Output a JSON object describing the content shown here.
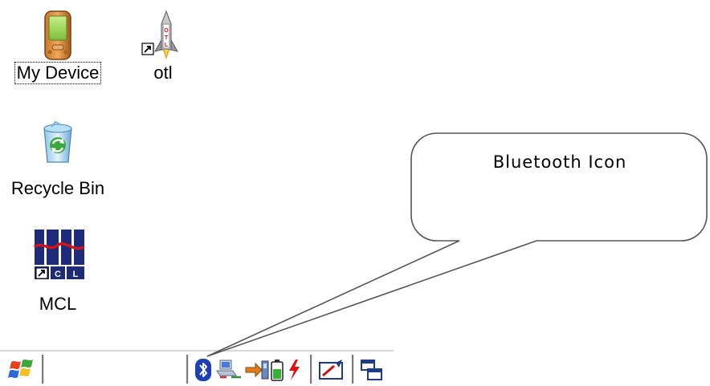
{
  "desktop": {
    "icons": [
      {
        "label": "My Device",
        "icon": "pda-device-icon",
        "focused": true
      },
      {
        "label": "otl",
        "icon": "rocket-shortcut-icon"
      },
      {
        "label": "Recycle Bin",
        "icon": "recycle-bin-icon"
      },
      {
        "label": "MCL",
        "icon": "mcl-shortcut-icon"
      }
    ]
  },
  "taskbar": {
    "start_icon": "windows-flag-icon",
    "tray_icons": [
      "bluetooth-icon",
      "network-icon",
      "connection-icon",
      "battery-icon",
      "power-icon",
      "input-panel-icon",
      "window-switch-icon"
    ]
  },
  "callout": {
    "text": "Bluetooth Icon"
  },
  "colors": {
    "bluetooth": "#1f3fb5",
    "power": "#e01010",
    "mcl_navy": "#1e2a7a",
    "mcl_red": "#d21414"
  }
}
